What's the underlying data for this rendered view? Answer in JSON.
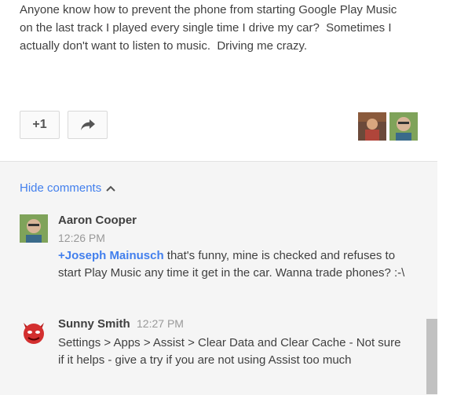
{
  "post": {
    "text": "Anyone know how to prevent the phone from starting Google Play Music on the last track I played every single time I drive my car?  Sometimes I actually don't want to listen to music.  Driving me crazy."
  },
  "actions": {
    "plus_one_label": "+1",
    "share_icon": "share-arrow-icon"
  },
  "comments_panel": {
    "hide_label": "Hide comments",
    "comments": [
      {
        "author": "Aaron Cooper",
        "time": "12:26 PM",
        "mention": "+Joseph Mainusch",
        "text": " that's funny, mine is checked and refuses to start Play Music any time it get in the car. Wanna trade phones? :-\\"
      },
      {
        "author": "Sunny Smith",
        "time": "12:27 PM",
        "text": "Settings > Apps > Assist > Clear Data  and Clear Cache - Not sure if it helps - give a try if you are not using Assist too much"
      }
    ]
  },
  "colors": {
    "link": "#427fed",
    "panel_bg": "#f5f5f5"
  }
}
